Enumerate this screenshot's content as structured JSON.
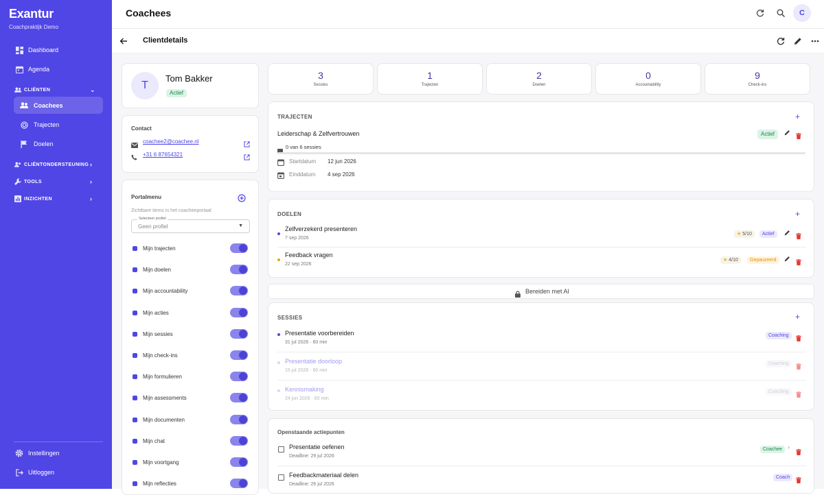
{
  "app": {
    "brand": "Exantur",
    "subtitle": "Coachpraktijk Demo"
  },
  "sidebar": {
    "dashboard": "Dashboard",
    "agenda": "Agenda",
    "clienten": "CLIËNTEN",
    "coachees": "Coachees",
    "trajecten": "Trajecten",
    "doelen": "Doelen",
    "clientondersteuning": "CLIËNTONDERSTEUNING",
    "tools": "TOOLS",
    "inzichten": "INZICHTEN",
    "instellingen": "Instellingen",
    "uitloggen": "Uitloggen"
  },
  "header": {
    "title": "Coachees",
    "avatar": "C",
    "subtitle": "Clientdetails"
  },
  "profile": {
    "initial": "T",
    "name": "Tom Bakker",
    "status": "Actief"
  },
  "contact": {
    "title": "Contact",
    "email": "coachee2@coachee.nl",
    "phone": "+31 6 87654321"
  },
  "portal": {
    "title": "Portalmenu",
    "desc": "Zichtbare items in het coacheeportaal",
    "select_label": "Selecteer profiel",
    "select_value": "Geen profiel",
    "items": [
      "Mijn trajecten",
      "Mijn doelen",
      "Mijn accountability",
      "Mijn acties",
      "Mijn sessies",
      "Mijn check-ins",
      "Mijn formulieren",
      "Mijn assessments",
      "Mijn documenten",
      "Mijn chat",
      "Mijn voortgang",
      "Mijn reflecties"
    ]
  },
  "stats": [
    {
      "value": "3",
      "label": "Sessies"
    },
    {
      "value": "1",
      "label": "Trajecten"
    },
    {
      "value": "2",
      "label": "Doelen"
    },
    {
      "value": "0",
      "label": "Accountability"
    },
    {
      "value": "9",
      "label": "Check-ins"
    }
  ],
  "trajecten": {
    "title": "TRAJECTEN",
    "name": "Leiderschap & Zelfvertrouwen",
    "status": "Actief",
    "progress_text": "0 van 6 sessies",
    "progress": 0,
    "start_label": "Startdatum",
    "start": "12 jun 2026",
    "end_label": "Einddatum",
    "end": "4 sep 2026"
  },
  "doelen": {
    "title": "DOELEN",
    "items": [
      {
        "name": "Zelfverzekerd presenteren",
        "date": "7 sep 2026",
        "score": "5/10",
        "status": "Actief",
        "color": "#5046e5"
      },
      {
        "name": "Feedback vragen",
        "date": "22 sep 2026",
        "score": "4/10",
        "status": "Gepauzeerd",
        "color": "#f0a400"
      }
    ]
  },
  "ai": {
    "label": "Bereiden met AI"
  },
  "sessies": {
    "title": "SESSIES",
    "items": [
      {
        "name": "Presentatie voorbereiden",
        "meta": "31 jul 2026 · 60 min",
        "type": "Coaching"
      },
      {
        "name": "Presentatie doorloop",
        "meta": "15 jul 2026 · 60 min",
        "type": "Coaching"
      },
      {
        "name": "Kennismaking",
        "meta": "24 jun 2026 · 60 min",
        "type": "Coaching"
      }
    ]
  },
  "acties": {
    "title": "Openstaande actiepunten",
    "items": [
      {
        "name": "Presentatie oefenen",
        "deadline": "Deadline: 29 jul 2026",
        "owner": "Coachee"
      },
      {
        "name": "Feedbackmateriaal delen",
        "deadline": "Deadline: 26 jul 2026",
        "owner": "Coach"
      }
    ]
  }
}
